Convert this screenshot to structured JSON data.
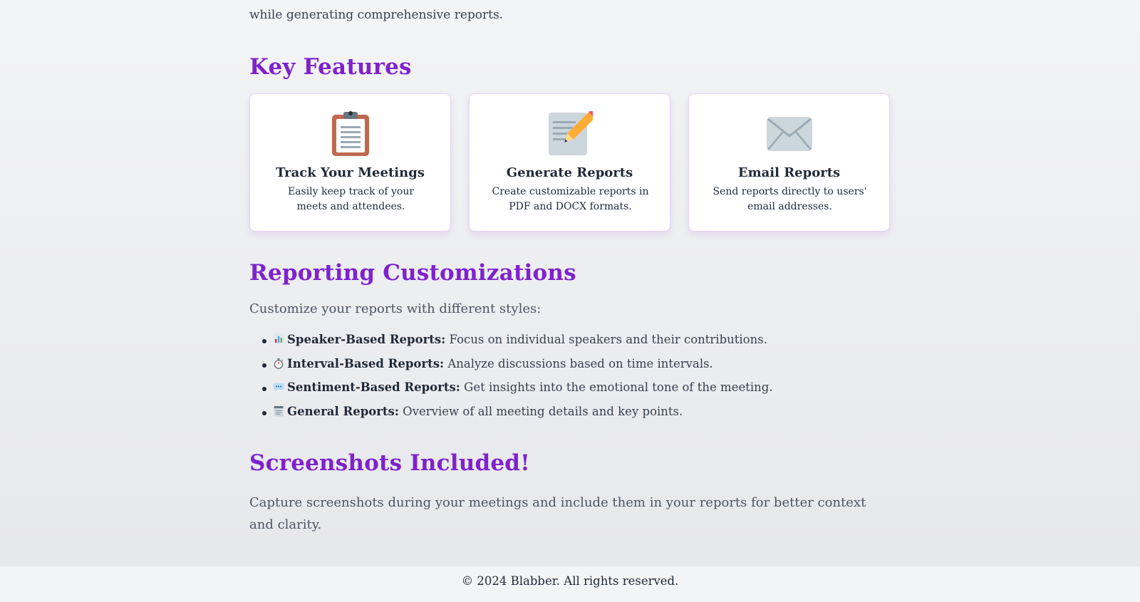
{
  "intro": {
    "tail": "while generating comprehensive reports."
  },
  "features": {
    "heading": "Key Features",
    "cards": [
      {
        "icon": "clipboard-icon",
        "title": "Track Your Meetings",
        "desc": "Easily keep track of your meets and attendees."
      },
      {
        "icon": "memo-pencil-icon",
        "title": "Generate Reports",
        "desc": "Create customizable reports in PDF and DOCX formats."
      },
      {
        "icon": "envelope-icon",
        "title": "Email Reports",
        "desc": "Send reports directly to users' email addresses."
      }
    ]
  },
  "customizations": {
    "heading": "Reporting Customizations",
    "intro": "Customize your reports with different styles:",
    "items": [
      {
        "icon": "bar-chart-icon",
        "label": "Speaker-Based Reports:",
        "text": " Focus on individual speakers and their contributions."
      },
      {
        "icon": "stopwatch-icon",
        "label": "Interval-Based Reports:",
        "text": " Analyze discussions based on time intervals."
      },
      {
        "icon": "speech-bubble-icon",
        "label": "Sentiment-Based Reports:",
        "text": " Get insights into the emotional tone of the meeting."
      },
      {
        "icon": "notepad-icon",
        "label": "General Reports:",
        "text": " Overview of all meeting details and key points."
      }
    ]
  },
  "screenshots": {
    "heading": "Screenshots Included!",
    "text": "Capture screenshots during your meetings and include them in your reports for better context and clarity."
  },
  "footer": {
    "text": "© 2024 Blabber. All rights reserved."
  },
  "colors": {
    "heading": "#7e22ce",
    "card_border": "#e4d3f3",
    "background": "#f3f4f6"
  }
}
